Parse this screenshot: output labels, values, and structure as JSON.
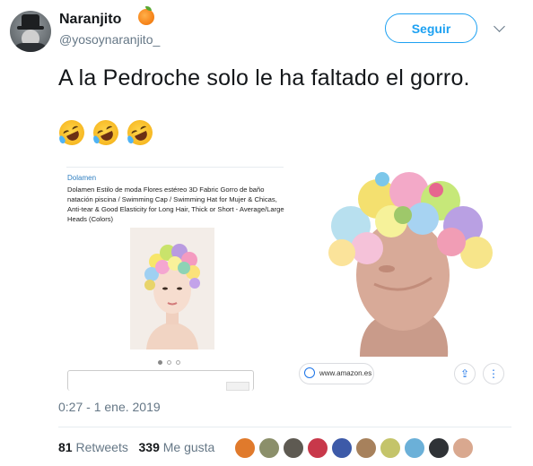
{
  "tweet": {
    "author_name": "Naranjito",
    "author_emoji_icon": "orange-emoji-icon",
    "handle": "@yosoynaranjito_",
    "follow_label": "Seguir",
    "text": "A la Pedroche solo le ha faltado el gorro.",
    "timestamp": "0:27 - 1 ene. 2019"
  },
  "media": {
    "emojis": [
      "rolling-on-floor-laughing-emoji-icon",
      "rolling-on-floor-laughing-emoji-icon",
      "rolling-on-floor-laughing-emoji-icon"
    ],
    "listing": {
      "brand": "Dolamen",
      "description": "Dolamen Estilo de moda Flores estéreo 3D Fabric Gorro de baño natación piscina / Swimming Cap / Swimming Hat for Mujer & Chicas, Anti-tear & Good Elasticity for Long Hair, Thick or Short - Average/Large Heads (Colors)"
    },
    "source_chip": "www.amazon.es"
  },
  "stats": {
    "retweets_count": "81",
    "retweets_label": "Retweets",
    "likes_count": "339",
    "likes_label": "Me gusta"
  },
  "colors": {
    "accent": "#1da1f2",
    "text": "#14171a",
    "muted": "#657786"
  }
}
